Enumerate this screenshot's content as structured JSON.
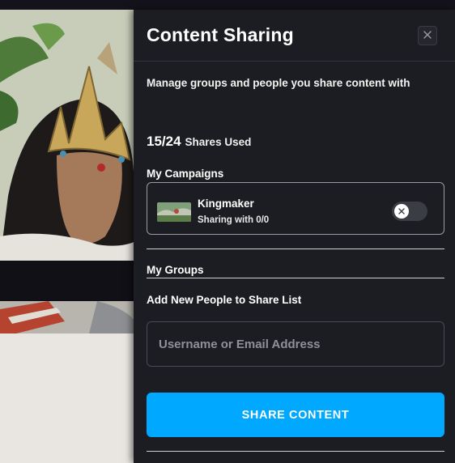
{
  "panel": {
    "title": "Content Sharing",
    "subtitle": "Manage groups and people you share content with",
    "shares_count": "15/24",
    "shares_label": "Shares Used",
    "campaigns_heading": "My Campaigns",
    "campaign": {
      "name": "Kingmaker",
      "sharing": "Sharing with 0/0"
    },
    "groups_heading": "My Groups",
    "add_people_heading": "Add New People to Share List",
    "input_placeholder": "Username or Email Address",
    "share_button_label": "SHARE CONTENT"
  },
  "icons": {
    "close": "close-icon",
    "toggle": "x-icon"
  },
  "colors": {
    "panel_bg": "#1c1d22",
    "accent": "#00a8ff",
    "toggle_track": "#3b3d44"
  }
}
